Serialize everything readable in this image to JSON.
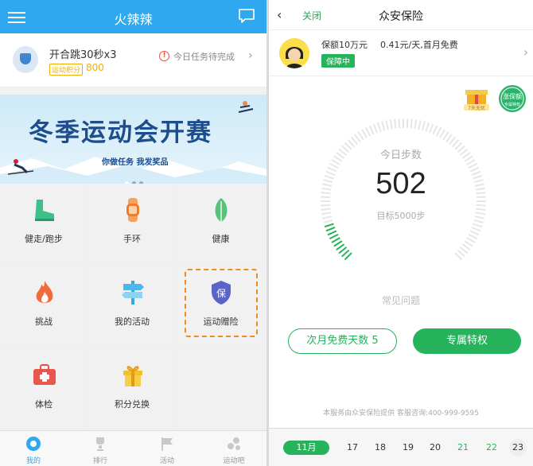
{
  "left": {
    "header_title": "火辣辣",
    "task": {
      "name": "开合跳30秒x3",
      "points_label": "运动积分",
      "points": "800",
      "status": "今日任务待完成"
    },
    "banner": {
      "title": "冬季运动会开赛",
      "subtitle": "你做任务 我发奖品"
    },
    "grid": [
      {
        "label": "健走/跑步",
        "icon": "shoe-icon"
      },
      {
        "label": "手环",
        "icon": "wristband-icon"
      },
      {
        "label": "健康",
        "icon": "leaf-icon"
      },
      {
        "label": "挑战",
        "icon": "flame-icon"
      },
      {
        "label": "我的活动",
        "icon": "signpost-icon"
      },
      {
        "label": "运动赠险",
        "icon": "shield-icon"
      },
      {
        "label": "体检",
        "icon": "medkit-icon"
      },
      {
        "label": "积分兑换",
        "icon": "gift-icon"
      }
    ],
    "tabs": [
      {
        "label": "我的",
        "icon": "home-icon"
      },
      {
        "label": "排行",
        "icon": "trophy-icon"
      },
      {
        "label": "活动",
        "icon": "flag-icon"
      },
      {
        "label": "运动吧",
        "icon": "bubbles-icon"
      }
    ]
  },
  "right": {
    "close_label": "关闭",
    "title": "众安保险",
    "policy": {
      "amount": "保额10万元",
      "price": "0.41元/天,首月免费",
      "tag": "保障中"
    },
    "badges": {
      "b1": "7天无忧",
      "b2_top": "涨保额",
      "b2_bottom": "专属特权"
    },
    "steps_label": "今日步数",
    "steps": "502",
    "goal": "目标5000步",
    "faq": "常见问题",
    "btn_free_days": "次月免费天数 5",
    "btn_privilege": "专属特权",
    "footer": "本服务由众安保险提供 客服咨询:400-999-9595",
    "month": "11月",
    "days": [
      "17",
      "18",
      "19",
      "20",
      "21",
      "22",
      "23"
    ],
    "steps_progress": 0.1
  },
  "colors": {
    "primary_blue": "#2fa8f0",
    "green": "#26b35b",
    "orange": "#f08c1e"
  }
}
